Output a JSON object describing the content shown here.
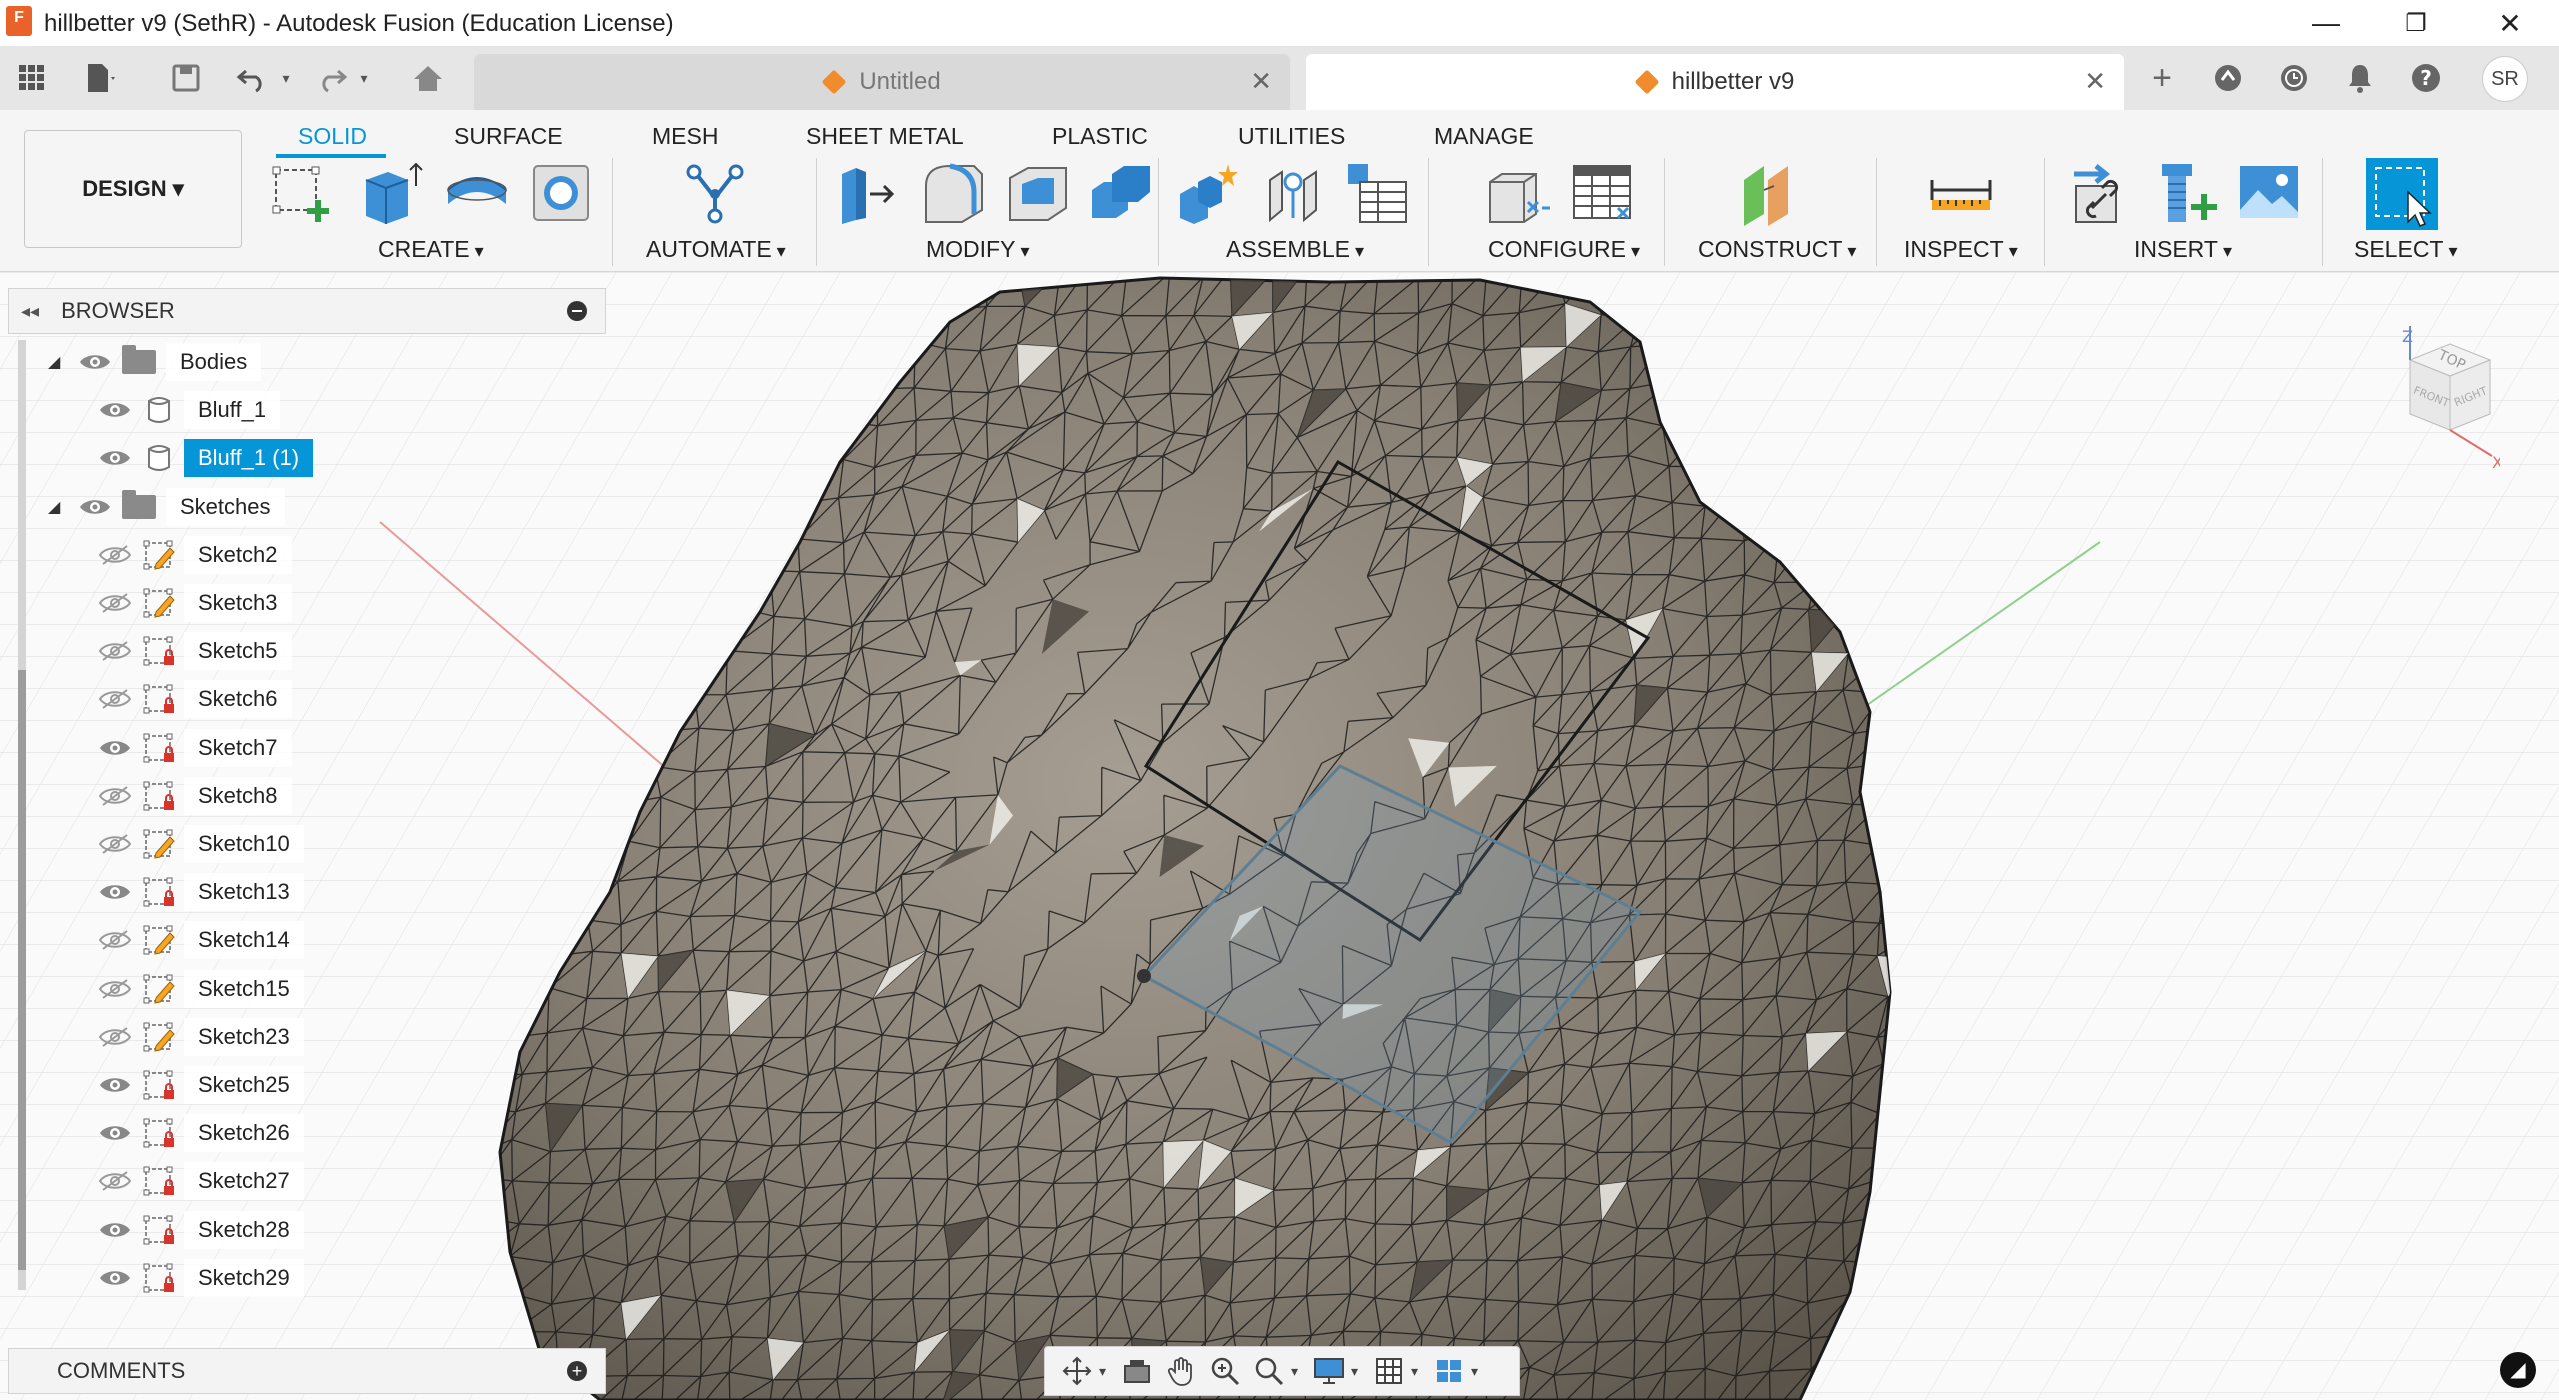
{
  "window": {
    "title": "hillbetter v9 (SethR) - Autodesk Fusion (Education License)",
    "app_icon_text": "F",
    "minimize": "—",
    "maximize": "❐",
    "close": "✕"
  },
  "tabs": [
    {
      "label": "Untitled",
      "active": false
    },
    {
      "label": "hillbetter v9",
      "active": true
    }
  ],
  "user": {
    "initials": "SR"
  },
  "workspace": {
    "label": "DESIGN ▾"
  },
  "ribbon_tabs": [
    "SOLID",
    "SURFACE",
    "MESH",
    "SHEET METAL",
    "PLASTIC",
    "UTILITIES",
    "MANAGE"
  ],
  "ribbon_groups": [
    "CREATE",
    "AUTOMATE",
    "MODIFY",
    "ASSEMBLE",
    "CONFIGURE",
    "CONSTRUCT",
    "INSPECT",
    "INSERT",
    "SELECT"
  ],
  "browser": {
    "title": "BROWSER",
    "folders": [
      {
        "label": "Bodies",
        "items": [
          {
            "label": "Bluff_1",
            "selected": false,
            "visible": true
          },
          {
            "label": "Bluff_1 (1)",
            "selected": true,
            "visible": true
          }
        ]
      },
      {
        "label": "Sketches",
        "items": [
          {
            "label": "Sketch2",
            "visible": false
          },
          {
            "label": "Sketch3",
            "visible": false
          },
          {
            "label": "Sketch5",
            "visible": false
          },
          {
            "label": "Sketch6",
            "visible": false
          },
          {
            "label": "Sketch7",
            "visible": true
          },
          {
            "label": "Sketch8",
            "visible": false
          },
          {
            "label": "Sketch10",
            "visible": false
          },
          {
            "label": "Sketch13",
            "visible": true
          },
          {
            "label": "Sketch14",
            "visible": false
          },
          {
            "label": "Sketch15",
            "visible": false
          },
          {
            "label": "Sketch23",
            "visible": false
          },
          {
            "label": "Sketch25",
            "visible": true
          },
          {
            "label": "Sketch26",
            "visible": true
          },
          {
            "label": "Sketch27",
            "visible": false
          },
          {
            "label": "Sketch28",
            "visible": true
          },
          {
            "label": "Sketch29",
            "visible": true
          }
        ]
      }
    ]
  },
  "comments": {
    "title": "COMMENTS"
  },
  "viewcube": {
    "top": "TOP",
    "front": "FRONT",
    "right": "RIGHT",
    "z": "Z",
    "x": "X"
  },
  "colors": {
    "accent": "#0696d7",
    "mesh_fill": "#8c8478",
    "mesh_edge": "#1a1a1a",
    "tab_orange": "#f08c2e"
  }
}
